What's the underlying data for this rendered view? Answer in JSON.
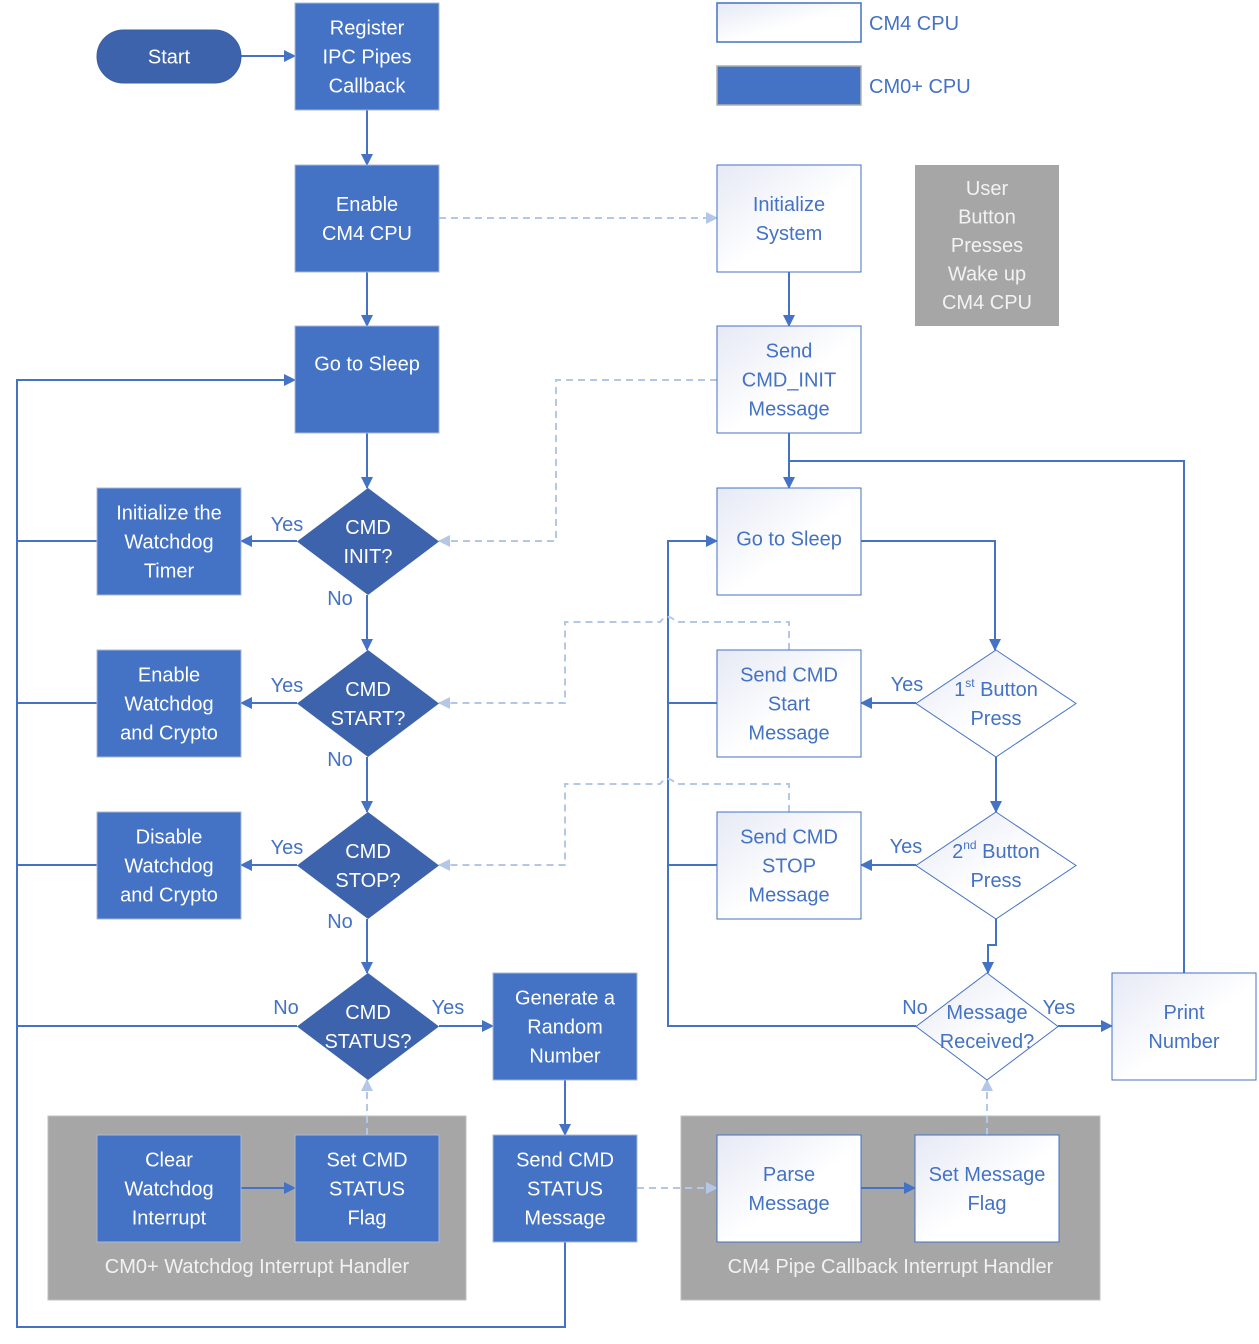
{
  "colors": {
    "cm0": "#4472c4",
    "cm0_dark": "#3c63ab",
    "cm4_fill_a": "#e9ecf6",
    "cm4_fill_b": "#ffffff",
    "cm4_border": "#4472c4",
    "gray": "#a6a6a6",
    "line": "#4472c4",
    "dashed": "#b4c7e7"
  },
  "legend": [
    {
      "id": "legend-cm4",
      "label": "CM4 CPU",
      "kind": "cm4"
    },
    {
      "id": "legend-cm0",
      "label": "CM0+ CPU",
      "kind": "cm0"
    }
  ],
  "note": {
    "lines": [
      "User",
      "Button",
      "Presses",
      "Wake up",
      "CM4 CPU"
    ]
  },
  "groups": [
    {
      "id": "cm0-watchdog-handler",
      "label": "CM0+ Watchdog Interrupt Handler"
    },
    {
      "id": "cm4-pipe-callback-handler",
      "label": "CM4 Pipe Callback Interrupt Handler"
    }
  ],
  "nodes": {
    "start": {
      "lines": [
        "Start"
      ],
      "kind": "terminal"
    },
    "register": {
      "lines": [
        "Register",
        "IPC Pipes",
        "Callback"
      ],
      "kind": "cm0"
    },
    "enable_cm4": {
      "lines": [
        "Enable",
        "CM4 CPU"
      ],
      "kind": "cm0"
    },
    "sleep0": {
      "lines": [
        "Go to Sleep"
      ],
      "kind": "cm0"
    },
    "cmd_init": {
      "lines": [
        "CMD",
        "INIT?"
      ],
      "kind": "cm0-decision"
    },
    "cmd_start": {
      "lines": [
        "CMD",
        "START?"
      ],
      "kind": "cm0-decision"
    },
    "cmd_stop": {
      "lines": [
        "CMD",
        "STOP?"
      ],
      "kind": "cm0-decision"
    },
    "cmd_status": {
      "lines": [
        "CMD",
        "STATUS?"
      ],
      "kind": "cm0-decision"
    },
    "init_wdt": {
      "lines": [
        "Initialize the",
        "Watchdog",
        "Timer"
      ],
      "kind": "cm0"
    },
    "enable_wdt": {
      "lines": [
        "Enable",
        "Watchdog",
        "and Crypto"
      ],
      "kind": "cm0"
    },
    "disable_wdt": {
      "lines": [
        "Disable",
        "Watchdog",
        "and Crypto"
      ],
      "kind": "cm0"
    },
    "gen_random": {
      "lines": [
        "Generate a",
        "Random",
        "Number"
      ],
      "kind": "cm0"
    },
    "send_status": {
      "lines": [
        "Send CMD",
        "STATUS",
        "Message"
      ],
      "kind": "cm0"
    },
    "clear_wdt": {
      "lines": [
        "Clear",
        "Watchdog",
        "Interrupt"
      ],
      "kind": "cm0"
    },
    "set_status_flag": {
      "lines": [
        "Set CMD",
        "STATUS",
        "Flag"
      ],
      "kind": "cm0"
    },
    "init_system": {
      "lines": [
        "Initialize",
        "System"
      ],
      "kind": "cm4"
    },
    "send_init": {
      "lines": [
        "Send",
        "CMD_INIT",
        "Message"
      ],
      "kind": "cm4"
    },
    "sleep4": {
      "lines": [
        "Go to Sleep"
      ],
      "kind": "cm4"
    },
    "send_start": {
      "lines": [
        "Send CMD",
        "Start",
        "Message"
      ],
      "kind": "cm4"
    },
    "send_stop": {
      "lines": [
        "Send CMD",
        "STOP",
        "Message"
      ],
      "kind": "cm4"
    },
    "btn1": {
      "lines": [
        "1|st| Button",
        "Press"
      ],
      "kind": "cm4-decision"
    },
    "btn2": {
      "lines": [
        "2|nd| Button",
        "Press"
      ],
      "kind": "cm4-decision"
    },
    "msg_recv": {
      "lines": [
        "Message",
        "Received?"
      ],
      "kind": "cm4-decision"
    },
    "print_num": {
      "lines": [
        "Print",
        "Number"
      ],
      "kind": "cm4"
    },
    "parse_msg": {
      "lines": [
        "Parse",
        "Message"
      ],
      "kind": "cm4"
    },
    "set_msg_flag": {
      "lines": [
        "Set Message",
        "Flag"
      ],
      "kind": "cm4"
    }
  },
  "edge_labels": {
    "yes": "Yes",
    "no": "No"
  }
}
